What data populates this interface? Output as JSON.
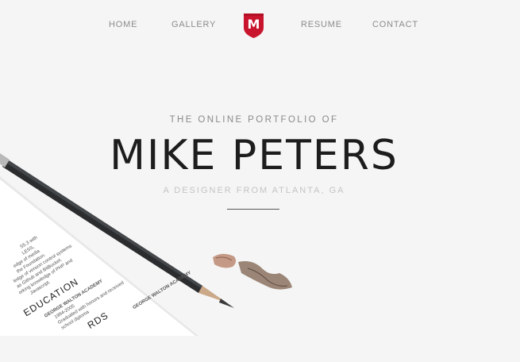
{
  "nav": {
    "items": [
      "HOME",
      "GALLERY",
      "RESUME",
      "CONTACT"
    ],
    "logo_letter": "M",
    "logo_color": "#c9142d"
  },
  "hero": {
    "kicker": "THE ONLINE PORTFOLIO OF",
    "name": "MIKE PETERS",
    "tagline": "A DESIGNER FROM ATLANTA, GA"
  },
  "photo": {
    "resume_lines": [
      "S5.3 with",
      "LESS,",
      "edge of media",
      "the Foundation.",
      "ledge of version control systems",
      "as Github and BitBucket.",
      "orking knowledge of PHP and",
      "Javascript."
    ],
    "section_education": "EDUCATION",
    "school_name": "GEORGE WALTON ACADEMY",
    "school_years": "1994-2005",
    "school_note_1": "Graduated with honors and received",
    "school_note_2": "school diploma",
    "section_awards": "RDS",
    "award_school": "GEORGE WALTON ACADEMY"
  },
  "colors": {
    "background": "#f5f5f5",
    "nav_text": "#8c8c8c",
    "accent": "#c9142d",
    "name_text": "#1d1d1d"
  }
}
